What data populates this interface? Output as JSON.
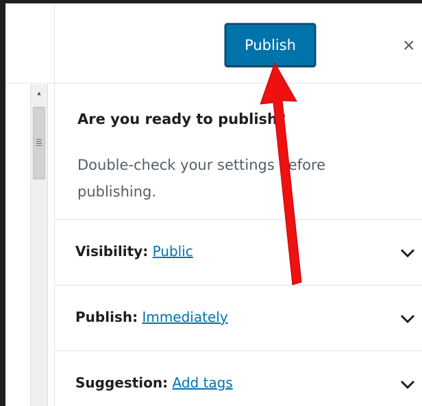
{
  "header": {
    "publish_label": "Publish",
    "close_label": "×"
  },
  "intro": {
    "title": "Are you ready to publish?",
    "text": "Double-check your settings before publishing."
  },
  "rows": [
    {
      "key": "Visibility:",
      "value": "Public"
    },
    {
      "key": "Publish:",
      "value": "Immediately"
    },
    {
      "key": "Suggestion:",
      "value": "Add tags"
    }
  ],
  "icons": {
    "chevron": "chevron-down-icon",
    "close": "close-icon",
    "scroll_up": "arrow-up-icon"
  },
  "colors": {
    "accent": "#0073aa",
    "annotation_arrow": "#ee1111"
  }
}
